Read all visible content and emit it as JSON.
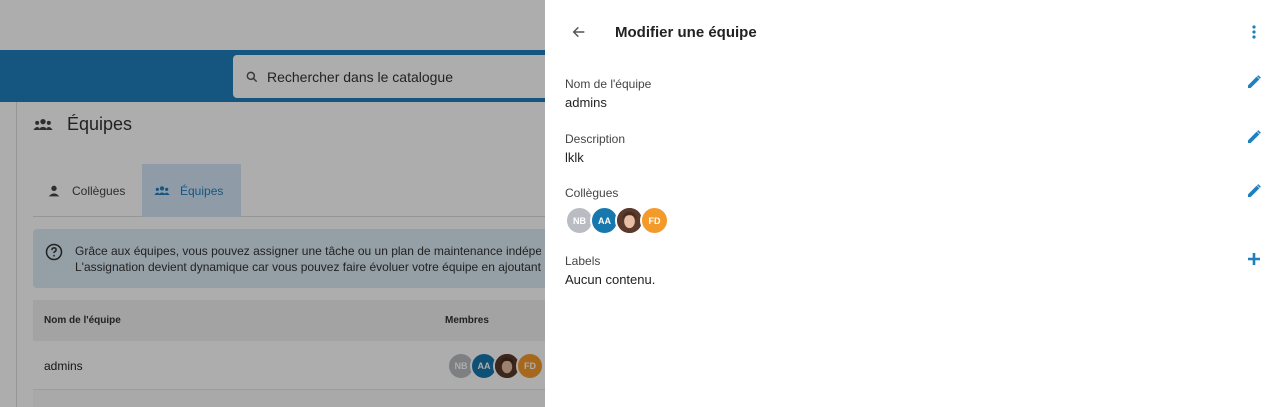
{
  "background": {
    "search": {
      "placeholder": "Rechercher dans le catalogue"
    },
    "page_title": "Équipes",
    "tabs": [
      {
        "label": "Collègues",
        "icon": "person-icon"
      },
      {
        "label": "Équipes",
        "icon": "group-icon",
        "active": true
      }
    ],
    "info": {
      "line1": "Grâce aux équipes, vous pouvez assigner une tâche ou un plan de maintenance indépend",
      "line2": "L'assignation devient dynamique car vous pouvez faire évoluer votre équipe en ajoutant et"
    },
    "table": {
      "headers": [
        "Nom de l'équipe",
        "Membres"
      ],
      "rows": [
        {
          "name": "admins",
          "members": [
            "NB",
            "AA",
            "photo",
            "FD"
          ]
        }
      ]
    }
  },
  "panel": {
    "title": "Modifier une équipe",
    "fields": {
      "name": {
        "label": "Nom de l'équipe",
        "value": "admins"
      },
      "description": {
        "label": "Description",
        "value": "lklk"
      },
      "colleagues": {
        "label": "Collègues",
        "avatars": [
          "NB",
          "AA",
          "photo",
          "FD"
        ]
      },
      "labels": {
        "label": "Labels",
        "value": "Aucun contenu."
      }
    }
  },
  "colors": {
    "accent": "#1f7fbf",
    "avatar_nb": "#b9bcc2",
    "avatar_aa": "#1778ae",
    "avatar_fd": "#f39a2a"
  }
}
